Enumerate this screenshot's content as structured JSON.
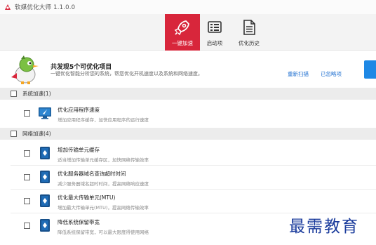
{
  "window": {
    "title": "软媒优化大师 1.1.0.0"
  },
  "toolbar": {
    "speed_label": "一键加速",
    "startup_label": "启动项",
    "history_label": "优化历史"
  },
  "banner": {
    "title": "共发现5个可优化项目",
    "subtitle": "一键优化智能分析您的系统，帮您优化开机速度以及系统和网络速度。",
    "rescan_label": "重新扫描",
    "ignored_label": "已忽略项"
  },
  "sections": {
    "system": {
      "label": "系统加速(1)"
    },
    "network": {
      "label": "网络加速(4)"
    }
  },
  "items": [
    {
      "title": "优化应用程序速度",
      "desc": "增加应用程序缓存，加快应用程序的运行速度"
    },
    {
      "title": "增加传输单元缓存",
      "desc": "适当增加传输单元缓存区，加快网络传输效率"
    },
    {
      "title": "优化服务器域名查询超时时间",
      "desc": "减少服务器域名超时时间，提高网络响应速度"
    },
    {
      "title": "优化最大传输单元(MTU)",
      "desc": "增加最大传输单元(MTU)，提高网络传输效率"
    },
    {
      "title": "降低系统保留带宽",
      "desc": "降低系统保留带宽，可以最大限度得使用网络"
    }
  ],
  "watermark": "最需教育",
  "colors": {
    "accent_red": "#d8263b",
    "link_blue": "#1e6fd0",
    "button_blue": "#1e88e5"
  }
}
